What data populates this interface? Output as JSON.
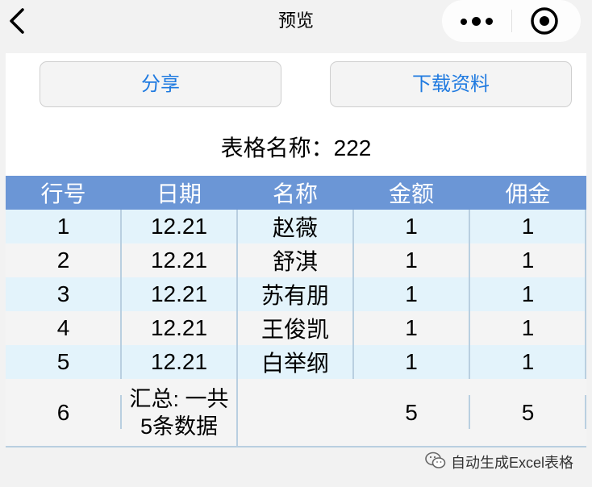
{
  "nav": {
    "title": "预览",
    "back_icon": "chevron-left-icon",
    "more_icon": "more-dots-icon",
    "close_icon": "target-circle-icon"
  },
  "actions": {
    "share_label": "分享",
    "download_label": "下载资料"
  },
  "table_name": "表格名称：222",
  "table": {
    "headers": [
      "行号",
      "日期",
      "名称",
      "金额",
      "佣金"
    ],
    "rows": [
      [
        "1",
        "12.21",
        "赵薇",
        "1",
        "1"
      ],
      [
        "2",
        "12.21",
        "舒淇",
        "1",
        "1"
      ],
      [
        "3",
        "12.21",
        "苏有朋",
        "1",
        "1"
      ],
      [
        "4",
        "12.21",
        "王俊凯",
        "1",
        "1"
      ],
      [
        "5",
        "12.21",
        "白举纲",
        "1",
        "1"
      ]
    ],
    "summary": {
      "row_no": "6",
      "label_line1": "汇总: 一共",
      "label_line2": "5条数据",
      "name": "",
      "amount_total": "5",
      "commission_total": "5"
    }
  },
  "watermark": {
    "icon": "wechat-icon",
    "text": "自动生成Excel表格"
  },
  "colors": {
    "header_bg": "#6b96d6",
    "odd_row_bg": "#e3f3fb",
    "even_row_bg": "#f4f4f4",
    "link_blue": "#1f7ae0"
  }
}
